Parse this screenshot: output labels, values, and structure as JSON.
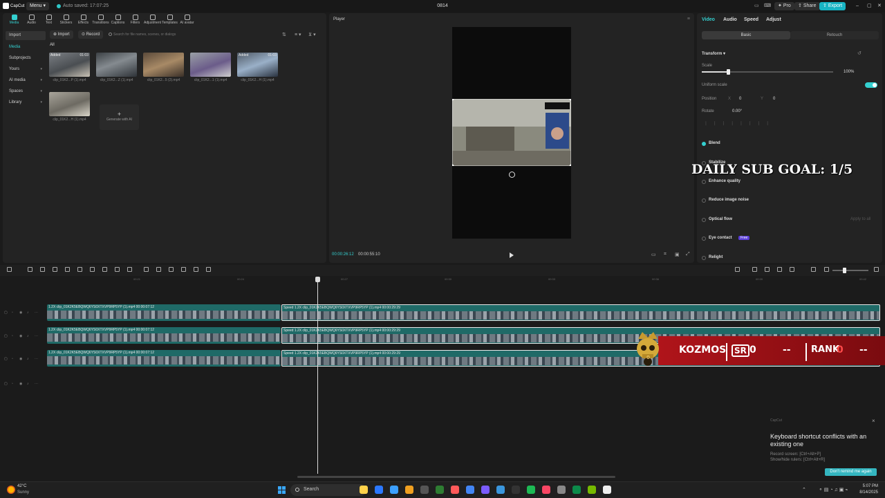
{
  "titlebar": {
    "logo": "CapCut",
    "menu": "Menu",
    "autosave": "Auto saved: 17:07:25",
    "project_title": "0814",
    "pro": "Pro",
    "share": "Share",
    "export": "Export"
  },
  "toolbar": [
    "Media",
    "Audio",
    "Text",
    "Stickers",
    "Effects",
    "Transitions",
    "Captions",
    "Filters",
    "Adjustment",
    "Templates",
    "AI avatar"
  ],
  "side_nav": [
    {
      "label": "Import"
    },
    {
      "label": "Media"
    },
    {
      "label": "Subprojects"
    },
    {
      "label": "Yours"
    },
    {
      "label": "AI media"
    },
    {
      "label": "Spaces"
    },
    {
      "label": "Library"
    }
  ],
  "media": {
    "import_label": "Import",
    "record_label": "Record",
    "search_placeholder": "Search for file names, scenes, or dialogs",
    "all_tab": "All",
    "added_badge": "Added",
    "generate_ai": "Generate with AI",
    "clips": [
      {
        "name": "clip_01K2...P (1).mp4",
        "duration": "01:03",
        "added": true
      },
      {
        "name": "clip_01K2...Z (1).mp4",
        "duration": "",
        "added": false
      },
      {
        "name": "clip_01K2...5 (2).mp4",
        "duration": "",
        "added": false
      },
      {
        "name": "clip_01K2...1 (1).mp4",
        "duration": "",
        "added": false
      },
      {
        "name": "clip_01K2...H (1).mp4",
        "duration": "01:03",
        "added": true
      },
      {
        "name": "clip_01K2...H (1).mp4",
        "duration": "",
        "added": false
      }
    ]
  },
  "player": {
    "label": "Player",
    "time_current": "00:00:26:12",
    "time_total": "00:00:55:10"
  },
  "props": {
    "tabs": [
      "Video",
      "Audio",
      "Speed",
      "Adjust"
    ],
    "seg_basic": "Basic",
    "seg_retouch": "Retouch",
    "transform": "Transform",
    "scale_label": "Scale",
    "scale_value": "100%",
    "uniform_scale": "Uniform scale",
    "position_label": "Position",
    "pos_x_label": "X",
    "pos_x": "0",
    "pos_y_label": "Y",
    "pos_y": "0",
    "rotate_label": "Rotate",
    "rotate_value": "0.00°",
    "blend": "Blend",
    "stabilize": "Stabilize",
    "enhance": "Enhance quality",
    "reduce_noise": "Reduce image noise",
    "optical_flow": "Optical flow",
    "apply_all": "Apply to all",
    "eye_contact": "Eye contact",
    "eye_badge": "Free",
    "relight": "Relight"
  },
  "timeline": {
    "ticks": [
      "00:21",
      "00:24",
      "00:27",
      "00:30",
      "00:33",
      "00:36",
      "00:39",
      "00:42"
    ],
    "clip_a_label": "1.2X  clip_01K2K5EBQWQ6YS0XTXVP9RP5YP (1).mp4  00:00:07:12",
    "clip_b_label": "Speed 1.2X  clip_01K2K5EBQWQ6YS0XTXVP9RP5YP (1).mp4  00:00:29:29"
  },
  "overlay": {
    "sub_goal": "DAILY SUB GOAL: 1/5",
    "name": "KOZMOS",
    "sr_badge": "SR",
    "sr_value": "0",
    "dash1": "--",
    "rank_label": "RANK",
    "rank_value": "0",
    "dash2": "--"
  },
  "toast": {
    "brand": "CapCut",
    "title": "Keyboard shortcut conflicts with an existing one",
    "line1": "Record screen: [Ctrl+Alt+P]",
    "line2": "Show/hide rulers: [Ctrl+Alt+R]",
    "button": "Don't remind me again"
  },
  "taskbar": {
    "temp": "42°C",
    "weather": "Sunny",
    "search": "Search",
    "time": "5:07 PM",
    "date": "8/14/2025"
  },
  "colors": {
    "accent": "#34d0d0",
    "clip": "#1f6a67",
    "overlay_red": "#b0141a"
  }
}
